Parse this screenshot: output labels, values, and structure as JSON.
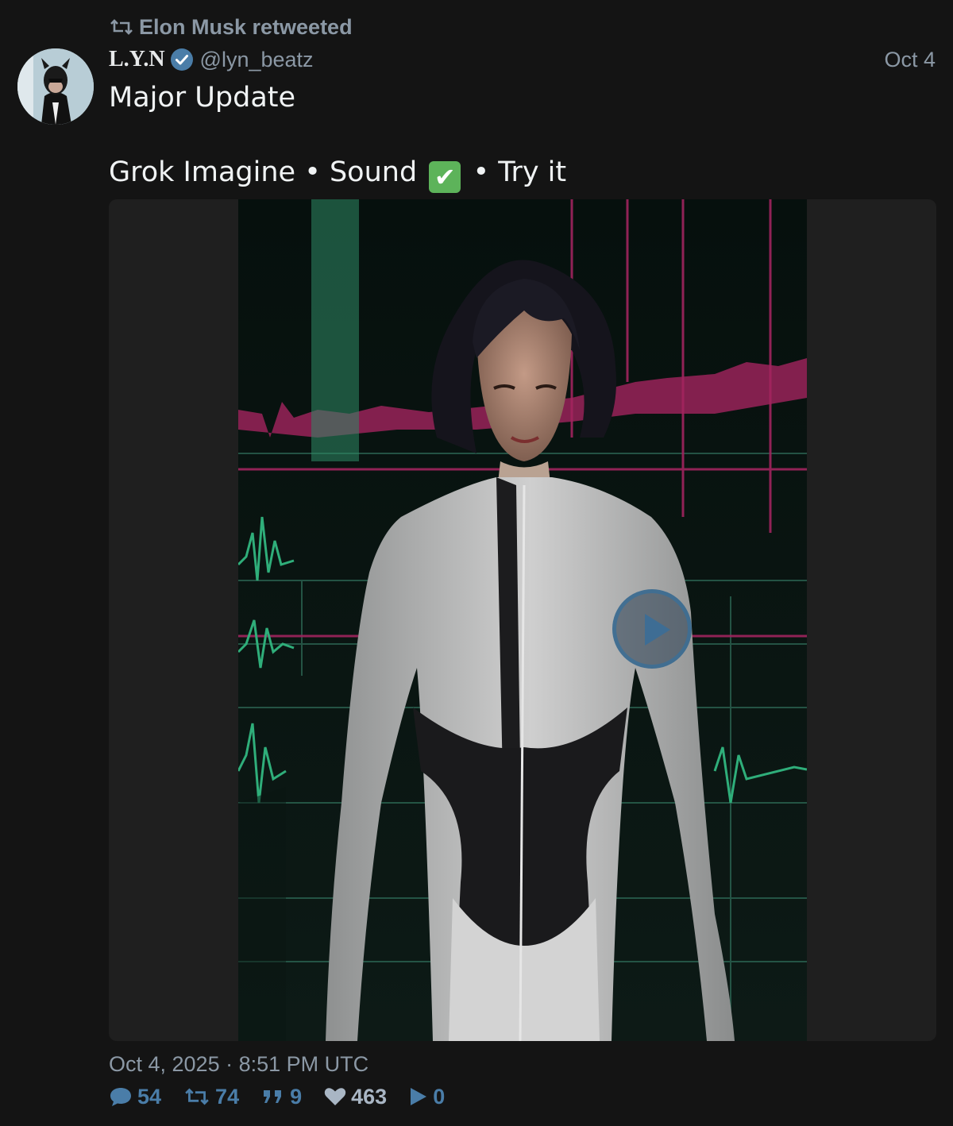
{
  "retweet": {
    "label": "Elon Musk retweeted",
    "icon": "retweet-icon"
  },
  "author": {
    "display_name": "L.Y.N",
    "handle": "@lyn_beatz",
    "verified_icon": "verified-badge-icon",
    "date_short": "Oct 4"
  },
  "tweet": {
    "line1": "Major Update",
    "line2_part1": "Grok Imagine • Sound ",
    "line2_emoji": "✔",
    "line2_part2": " • Try it"
  },
  "media": {
    "type": "video",
    "play_icon": "play-icon"
  },
  "timestamp": "Oct 4, 2025 · 8:51 PM UTC",
  "stats": {
    "replies": "54",
    "retweets": "74",
    "quotes": "9",
    "likes": "463",
    "views": "0"
  },
  "colors": {
    "background": "#141414",
    "text": "#e7e9ea",
    "muted": "#8b98a5",
    "accent": "#4a7da8"
  }
}
